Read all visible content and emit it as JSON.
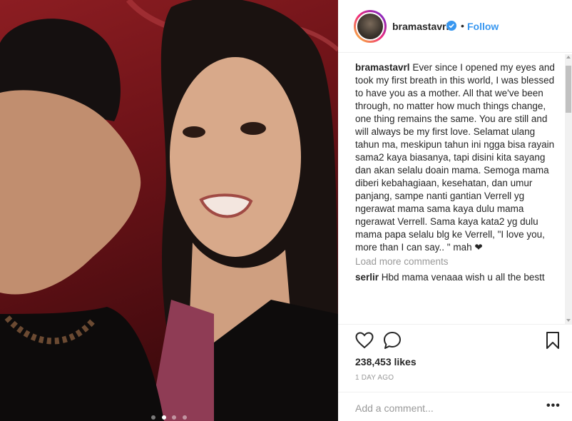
{
  "post": {
    "username": "bramastavrl",
    "separator": "•",
    "follow_label": "Follow",
    "caption": "Ever since I opened my eyes and took my first breath in this world, I was blessed to have you as a mother. All that we've been through, no matter how much things change, one thing remains the same. You are still and will always be my first love. Selamat ulang tahun ma, meskipun tahun ini ngga bisa rayain sama2 kaya biasanya, tapi disini kita sayang dan akan selalu doain mama. Semoga mama diberi kebahagiaan, kesehatan, dan umur panjang, sampe nanti gantian Verrell yg ngerawat mama sama kaya dulu mama ngerawat Verrell. Sama kaya kata2 yg dulu mama papa selalu blg ke Verrell, \"I love you, more than I can say.. \" mah ❤",
    "load_more_label": "Load more comments",
    "comments": [
      {
        "username": "serlir",
        "text": "Hbd mama venaaa wish u all the bestt"
      }
    ],
    "likes": "238,453 likes",
    "time": "1 DAY AGO",
    "add_comment_placeholder": "Add a comment...",
    "more_options": "•••"
  },
  "carousel": {
    "count": 4,
    "active_index": 1
  },
  "icons": {
    "like": "heart-outline-icon",
    "comment": "speech-bubble-icon",
    "save": "bookmark-icon",
    "verified": "verified-badge-icon"
  },
  "colors": {
    "accent": "#3897f0",
    "text": "#262626",
    "muted": "#999999",
    "border": "#efefef"
  }
}
